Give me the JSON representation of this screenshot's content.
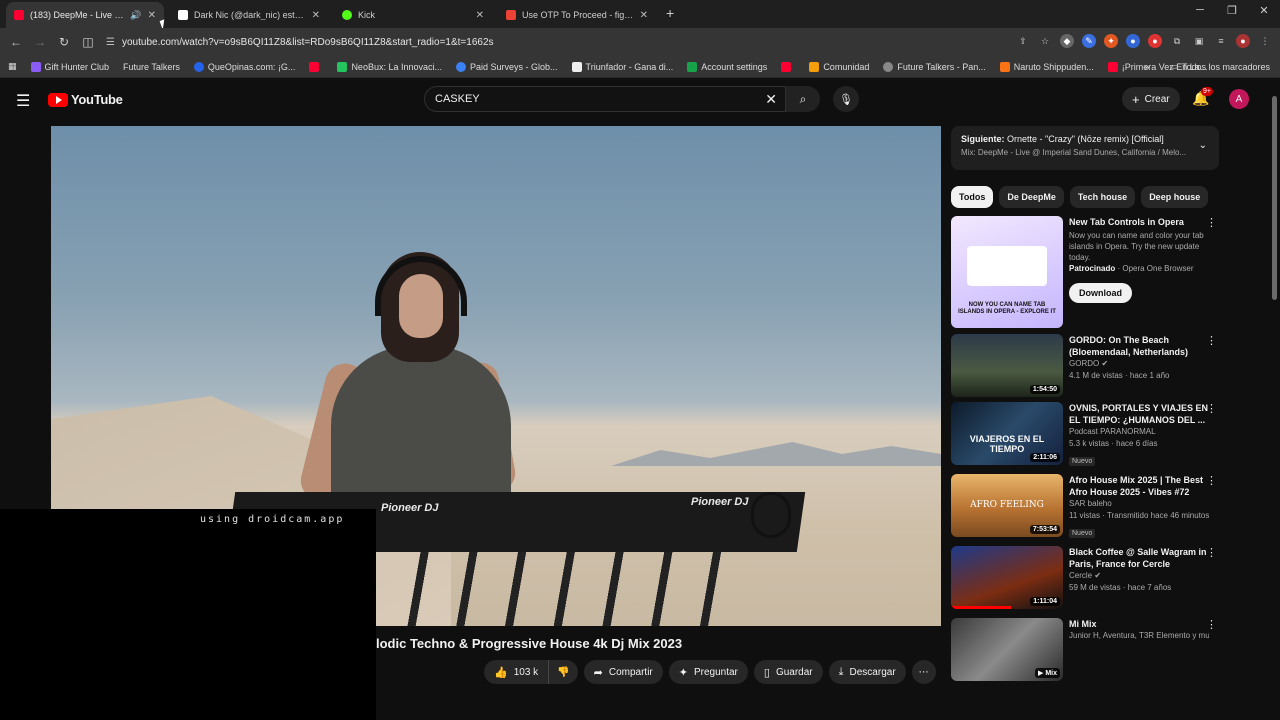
{
  "tabs": [
    {
      "title": "(183) DeepMe - Live @ Imp",
      "color": "#ff0033",
      "active": true
    },
    {
      "title": "Dark Nic (@dark_nic) está LIVE",
      "color": "#ffffff"
    },
    {
      "title": "Kick",
      "color": "#53fc18"
    },
    {
      "title": "Use OTP To Proceed - figue415",
      "color": "#ea4335"
    }
  ],
  "address": "youtube.com/watch?v=o9sB6QI11Z8&list=RDo9sB6QI11Z8&start_radio=1&t=1662s",
  "bookmarks": [
    "Gift Hunter Club",
    "Future Talkers",
    "QueOpinas.com: ¡G...",
    "",
    "NeoBux: La Innovaci...",
    "Paid Surveys - Glob...",
    "Triunfador - Gana di...",
    "Account settings",
    "",
    "Comunidad",
    "Future Talkers - Pan...",
    "Naruto Shippuden...",
    "¡Primera Vez En La..."
  ],
  "bookmarks_right": "Todos los marcadores",
  "youtube": {
    "logo": "YouTube",
    "search_value": "CASKEY",
    "create": "Crear",
    "notif_badge": "9+",
    "avatar": "A"
  },
  "video": {
    "title_visible": "lodic Techno & Progressive House 4k Dj Mix 2023",
    "overlay_text": "using droidcam.app",
    "deck_brand_left": "Pioneer DJ",
    "deck_brand_right": "Pioneer DJ",
    "likes": "103 k",
    "share": "Compartir",
    "ask": "Preguntar",
    "save": "Guardar",
    "download": "Descargar"
  },
  "sidebar": {
    "next_label": "Siguiente:",
    "next_title": "Ornette - \"Crazy\" (Nōze remix) [Official]",
    "next_sub": "Mix: DeepMe - Live @ Imperial Sand Dunes, California / Melo...",
    "chips": [
      "Todos",
      "De DeepMe",
      "Tech house",
      "Deep house"
    ],
    "ad": {
      "title": "New Tab Controls in Opera",
      "desc": "Now you can name and color your tab islands in Opera. Try the new update today.",
      "sponsored": "Patrocinado",
      "advertiser": "Opera One Browser",
      "button": "Download",
      "thumb_text": "NOW YOU CAN NAME TAB ISLANDS IN OPERA - EXPLORE IT"
    },
    "videos": [
      {
        "title": "GORDO: On The Beach (Bloemendaal, Netherlands)",
        "channel": "GORDO",
        "stats": "4.1 M de vistas · hace 1 año",
        "duration": "1:54:50",
        "nuevo": ""
      },
      {
        "title": "OVNIS, PORTALES Y VIAJES EN EL TIEMPO: ¿HUMANOS DEL ...",
        "channel": "Podcast PARANORMAL",
        "stats": "5.3 k vistas · hace 6 días",
        "duration": "2:11:06",
        "nuevo": "Nuevo",
        "thumb_text": "VIAJEROS EN EL TIEMPO"
      },
      {
        "title": "Afro House Mix 2025 | The Best Afro House 2025 - Vibes #72",
        "channel": "SAR baleho",
        "stats": "11 vistas · Transmitido hace 46 minutos",
        "duration": "7:53:54",
        "nuevo": "Nuevo",
        "thumb_text": "AFRO FEELING"
      },
      {
        "title": "Black Coffee @ Salle Wagram in Paris, France for Cercle",
        "channel": "Cercle",
        "stats": "59 M de vistas · hace 7 años",
        "duration": "1:11:04",
        "nuevo": ""
      },
      {
        "title": "Mi Mix",
        "channel": "Junior H, Aventura, T3R Elemento y muc...",
        "stats": "",
        "duration": "Mix",
        "nuevo": ""
      }
    ]
  }
}
